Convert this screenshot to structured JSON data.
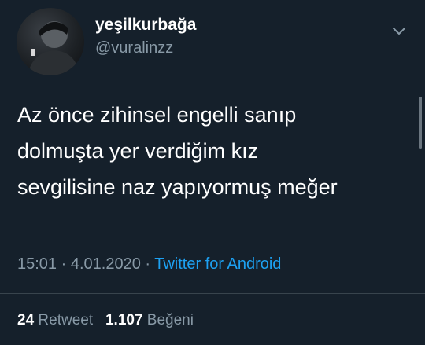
{
  "user": {
    "display_name": "yeşilkurbağa",
    "handle": "@vuralinzz"
  },
  "tweet": {
    "lines": [
      "Az önce zihinsel engelli sanıp",
      "dolmuşta yer verdiğim kız",
      "sevgilisine naz yapıyormuş meğer"
    ]
  },
  "meta": {
    "time": "15:01",
    "sep1": " · ",
    "date": "4.01.2020",
    "sep2": " · ",
    "source": "Twitter for Android"
  },
  "stats": {
    "retweet_count": "24",
    "retweet_label": "Retweet",
    "like_count": "1.107",
    "like_label": "Beğeni"
  },
  "icons": {
    "menu": "chevron-down-icon",
    "avatar": "avatar"
  },
  "colors": {
    "background": "#15202b",
    "secondary_text": "#8899a6",
    "link": "#1da1f2"
  }
}
